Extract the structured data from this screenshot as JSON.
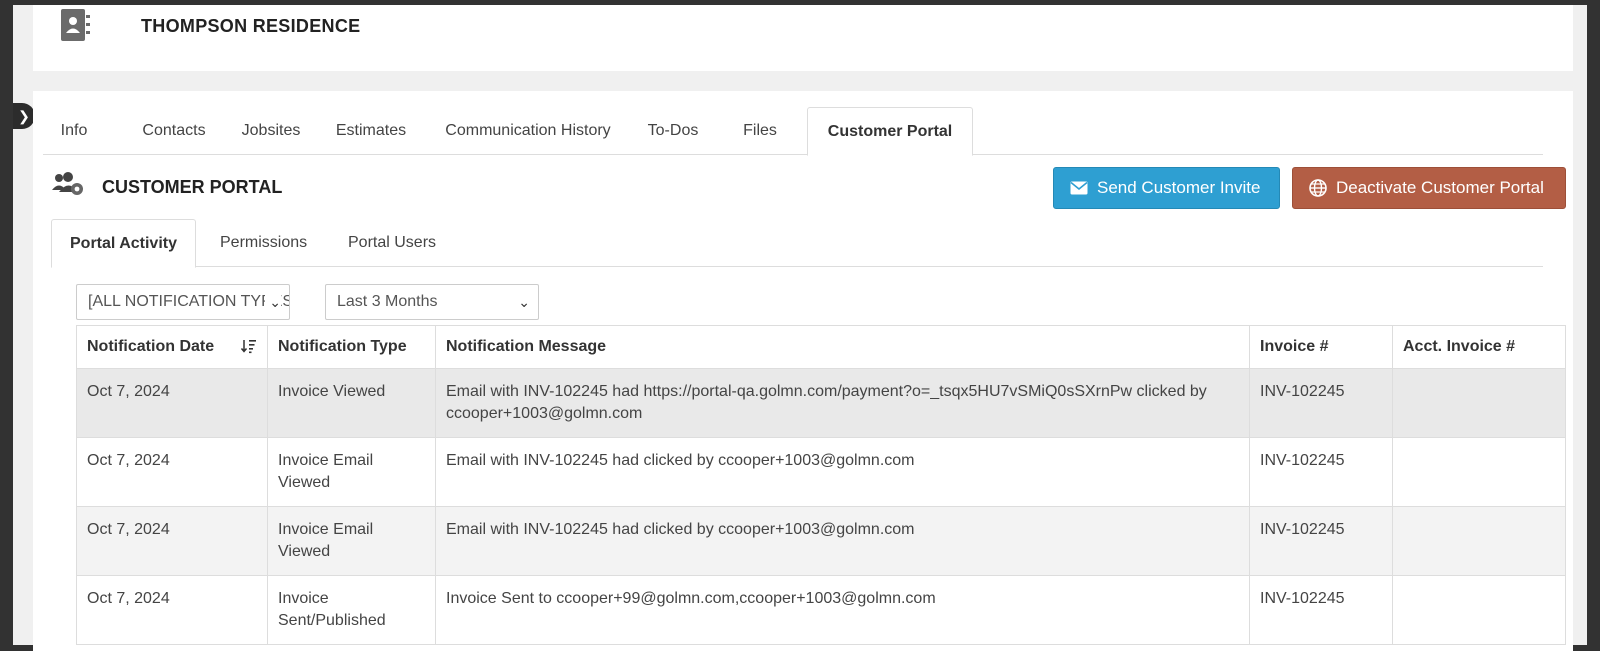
{
  "header": {
    "title": "THOMPSON RESIDENCE"
  },
  "tabs": [
    {
      "label": "Info"
    },
    {
      "label": "Contacts"
    },
    {
      "label": "Jobsites"
    },
    {
      "label": "Estimates"
    },
    {
      "label": "Communication History"
    },
    {
      "label": "To-Dos"
    },
    {
      "label": "Files"
    },
    {
      "label": "Customer Portal",
      "active": true
    }
  ],
  "portal": {
    "title": "CUSTOMER PORTAL",
    "invite_button": "Send Customer Invite",
    "deactivate_button": "Deactivate Customer Portal",
    "invite_color": "#2e9fd2",
    "deactivate_color": "#b35e45"
  },
  "subtabs": [
    {
      "label": "Portal Activity",
      "active": true
    },
    {
      "label": "Permissions"
    },
    {
      "label": "Portal Users"
    }
  ],
  "filters": {
    "notification_type": "[ALL NOTIFICATION TYPES]",
    "date_range": "Last 3 Months"
  },
  "table": {
    "headers": [
      "Notification Date",
      "Notification Type",
      "Notification Message",
      "Invoice #",
      "Acct. Invoice #"
    ],
    "rows": [
      [
        "Oct 7, 2024",
        "Invoice Viewed",
        "Email with INV-102245 had https://portal-qa.golmn.com/payment?o=_tsqx5HU7vSMiQ0sSXrnPw clicked by ccooper+1003@golmn.com",
        "INV-102245",
        ""
      ],
      [
        "Oct 7, 2024",
        "Invoice Email Viewed",
        "Email with INV-102245 had clicked by ccooper+1003@golmn.com",
        "INV-102245",
        ""
      ],
      [
        "Oct 7, 2024",
        "Invoice Email Viewed",
        "Email with INV-102245 had clicked by ccooper+1003@golmn.com",
        "INV-102245",
        ""
      ],
      [
        "Oct 7, 2024",
        "Invoice Sent/Published",
        "Invoice Sent to ccooper+99@golmn.com,ccooper+1003@golmn.com",
        "INV-102245",
        ""
      ]
    ]
  },
  "icons": {
    "contact_book": "address-book-icon",
    "portal": "users-gear-icon",
    "invite": "envelope-icon",
    "deactivate": "globe-icon",
    "sort": "sort-descending-icon",
    "sidebar": "chevron-right-icon"
  }
}
